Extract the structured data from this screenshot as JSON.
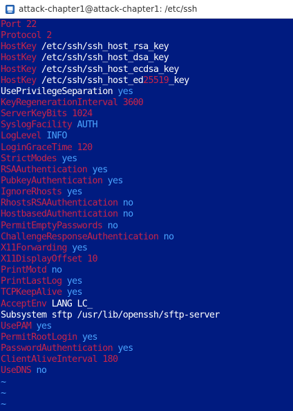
{
  "window": {
    "title": "attack-chapter1@attack-chapter1: /etc/ssh",
    "icon": "terminal-app-icon"
  },
  "colors": {
    "background": "#001b80",
    "directive": "#c8244a",
    "boolean_value": "#4aa3ff",
    "text_value": "#ffffff",
    "number_value": "#c8244a"
  },
  "lines": [
    {
      "key": "Port",
      "val": "22",
      "type": "num"
    },
    {
      "key": "Protocol",
      "val": "2",
      "type": "num"
    },
    {
      "key": "HostKey",
      "val": "/etc/ssh/ssh_host_rsa_key",
      "type": "plain"
    },
    {
      "key": "HostKey",
      "val": "/etc/ssh/ssh_host_dsa_key",
      "type": "plain"
    },
    {
      "key": "HostKey",
      "val": "/etc/ssh/ssh_host_ecdsa_key",
      "type": "plain"
    },
    {
      "key": "HostKey",
      "val_parts": [
        "/etc/ssh/ssh_host_ed",
        "25519",
        "_key"
      ],
      "type": "mixed"
    },
    {
      "key": "UsePrivilegeSeparation",
      "val": "yes",
      "type": "kw",
      "key_white": true
    },
    {
      "key": "KeyRegenerationInterval",
      "val": "3600",
      "type": "num"
    },
    {
      "key": "ServerKeyBits",
      "val": "1024",
      "type": "num"
    },
    {
      "key": "SyslogFacility",
      "val": "AUTH",
      "type": "kw"
    },
    {
      "key": "LogLevel",
      "val": "INFO",
      "type": "kw"
    },
    {
      "key": "LoginGraceTime",
      "val": "120",
      "type": "num"
    },
    {
      "key": "StrictModes",
      "val": "yes",
      "type": "kw"
    },
    {
      "key": "RSAAuthentication",
      "val": "yes",
      "type": "kw"
    },
    {
      "key": "PubkeyAuthentication",
      "val": "yes",
      "type": "kw"
    },
    {
      "key": "IgnoreRhosts",
      "val": "yes",
      "type": "kw"
    },
    {
      "key": "RhostsRSAAuthentication",
      "val": "no",
      "type": "kw"
    },
    {
      "key": "HostbasedAuthentication",
      "val": "no",
      "type": "kw"
    },
    {
      "key": "PermitEmptyPasswords",
      "val": "no",
      "type": "kw"
    },
    {
      "key": "ChallengeResponseAuthentication",
      "val": "no",
      "type": "kw"
    },
    {
      "key": "X11Forwarding",
      "val": "yes",
      "type": "kw"
    },
    {
      "key": "X11DisplayOffset",
      "val": "10",
      "type": "num"
    },
    {
      "key": "PrintMotd",
      "val": "no",
      "type": "kw"
    },
    {
      "key": "PrintLastLog",
      "val": "yes",
      "type": "kw"
    },
    {
      "key": "TCPKeepAlive",
      "val": "yes",
      "type": "kw"
    },
    {
      "key": "AcceptEnv",
      "val": "LANG LC_",
      "type": "plain",
      "cursor": true
    },
    {
      "key": "Subsystem",
      "val": "sftp /usr/lib/openssh/sftp-server",
      "type": "plain",
      "key_white": true
    },
    {
      "key": "UsePAM",
      "val": "yes",
      "type": "kw"
    },
    {
      "key": "PermitRootLogin",
      "val": "yes",
      "type": "kw"
    },
    {
      "key": "PasswordAuthentication",
      "val": "yes",
      "type": "kw"
    },
    {
      "key": "ClientAliveInterval",
      "val": "180",
      "type": "num"
    },
    {
      "key": "UseDNS",
      "val": "no",
      "type": "kw"
    }
  ],
  "empty_line_marker": "~",
  "empty_line_count": 3
}
